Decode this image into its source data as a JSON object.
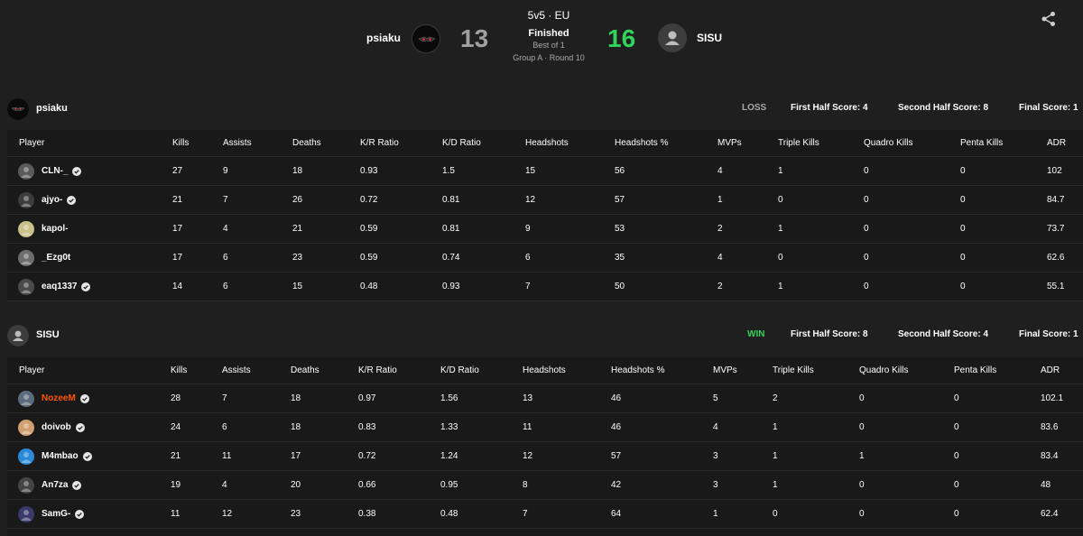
{
  "match": {
    "mode": "5v5 · EU",
    "status": "Finished",
    "best_of": "Best of 1",
    "round_info": "Group A · Round 10"
  },
  "team1": {
    "name": "psiaku",
    "score": "13",
    "result": "LOSS",
    "result_color": "#a9a9a9",
    "first_half": "First Half Score: 4",
    "second_half": "Second Half Score: 8",
    "final": "Final Score: 1",
    "players": [
      {
        "name": "CLN-_",
        "verified": true,
        "stats": [
          "27",
          "9",
          "18",
          "0.93",
          "1.5",
          "15",
          "56",
          "4",
          "1",
          "0",
          "0",
          "102"
        ]
      },
      {
        "name": "ajyo-",
        "verified": true,
        "stats": [
          "21",
          "7",
          "26",
          "0.72",
          "0.81",
          "12",
          "57",
          "1",
          "0",
          "0",
          "0",
          "84.7"
        ]
      },
      {
        "name": "kapol-",
        "verified": false,
        "stats": [
          "17",
          "4",
          "21",
          "0.59",
          "0.81",
          "9",
          "53",
          "2",
          "1",
          "0",
          "0",
          "73.7"
        ]
      },
      {
        "name": "_Ezg0t",
        "verified": false,
        "stats": [
          "17",
          "6",
          "23",
          "0.59",
          "0.74",
          "6",
          "35",
          "4",
          "0",
          "0",
          "0",
          "62.6"
        ]
      },
      {
        "name": "eaq1337",
        "verified": true,
        "stats": [
          "14",
          "6",
          "15",
          "0.48",
          "0.93",
          "7",
          "50",
          "2",
          "1",
          "0",
          "0",
          "55.1"
        ]
      }
    ]
  },
  "team2": {
    "name": "SISU",
    "score": "16",
    "result": "WIN",
    "result_color": "#32d35a",
    "first_half": "First Half Score: 8",
    "second_half": "Second Half Score: 4",
    "final": "Final Score: 1",
    "players": [
      {
        "name": "NozeeM",
        "verified": true,
        "highlight": true,
        "stats": [
          "28",
          "7",
          "18",
          "0.97",
          "1.56",
          "13",
          "46",
          "5",
          "2",
          "0",
          "0",
          "102.1"
        ]
      },
      {
        "name": "doivob",
        "verified": true,
        "stats": [
          "24",
          "6",
          "18",
          "0.83",
          "1.33",
          "11",
          "46",
          "4",
          "1",
          "0",
          "0",
          "83.6"
        ]
      },
      {
        "name": "M4mbao",
        "verified": true,
        "stats": [
          "21",
          "11",
          "17",
          "0.72",
          "1.24",
          "12",
          "57",
          "3",
          "1",
          "1",
          "0",
          "83.4"
        ]
      },
      {
        "name": "An7za",
        "verified": true,
        "stats": [
          "19",
          "4",
          "20",
          "0.66",
          "0.95",
          "8",
          "42",
          "3",
          "1",
          "0",
          "0",
          "48"
        ]
      },
      {
        "name": "SamG-",
        "verified": true,
        "stats": [
          "11",
          "12",
          "23",
          "0.38",
          "0.48",
          "7",
          "64",
          "1",
          "0",
          "0",
          "0",
          "62.4"
        ]
      }
    ]
  },
  "columns": [
    "Player",
    "Kills",
    "Assists",
    "Deaths",
    "K/R Ratio",
    "K/D Ratio",
    "Headshots",
    "Headshots %",
    "MVPs",
    "Triple Kills",
    "Quadro Kills",
    "Penta Kills",
    "ADR"
  ],
  "icons": {
    "share": "share-icon",
    "verified": "verified-check-icon",
    "default_avatar": "user-avatar-icon"
  },
  "colors": {
    "win": "#32d35a",
    "loss_score": "#a0a0a0",
    "highlight_player": "#ff5500"
  }
}
